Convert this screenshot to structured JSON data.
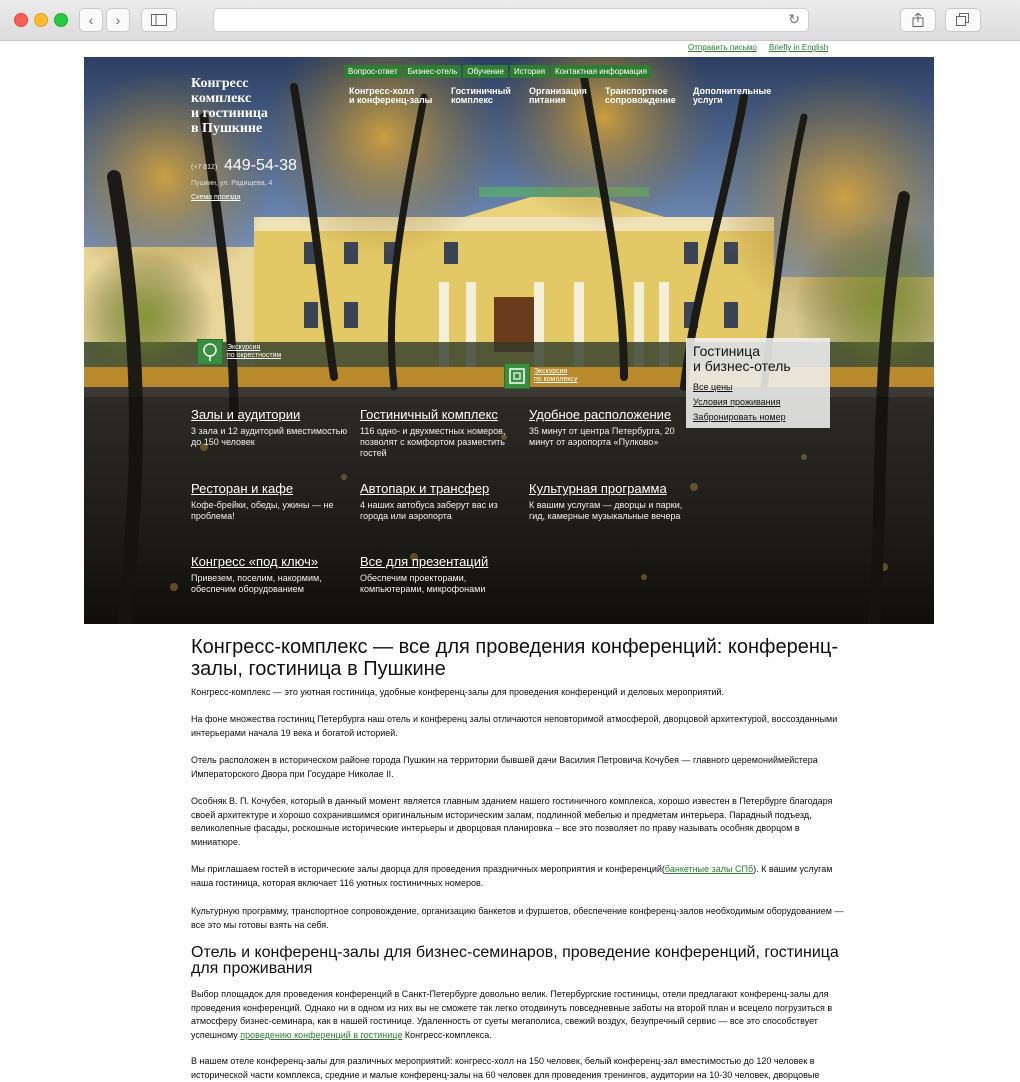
{
  "utility_links": {
    "send_letter": "Отправить письмо",
    "english": "Briefly in English"
  },
  "logo": {
    "line1": "Конгресс",
    "line2": "комплекс",
    "line3": "и гостиница",
    "line4": "в Пушкине"
  },
  "contact": {
    "phone_prefix": "(+7 812)",
    "phone": "449-54-38",
    "address": "Пушкин, ул. Радищева, 4",
    "scheme": "Схема проезда"
  },
  "top_nav": [
    "Вопрос-ответ",
    "Бизнес-отель",
    "Обучение",
    "История",
    "Контактная информация"
  ],
  "main_nav": [
    {
      "line1": "Конгресс-холл",
      "line2": "и конференц-залы"
    },
    {
      "line1": "Гостиничный",
      "line2": "комплекс"
    },
    {
      "line1": "Организация",
      "line2": "питания"
    },
    {
      "line1": "Транспортное",
      "line2": "сопровождение"
    },
    {
      "line1": "Дополнительные",
      "line2": "услуги"
    }
  ],
  "tours": {
    "surroundings": {
      "line1": "Экскурсия",
      "line2": "по окрестностям"
    },
    "complex": {
      "line1": "Экскурсия",
      "line2": "по комплексу"
    }
  },
  "hotel_box": {
    "title_line1": "Гостиница",
    "title_line2": "и бизнес-отель",
    "prices": "Все цены",
    "conditions": "Условия проживания",
    "book": "Забронировать номер"
  },
  "features": [
    {
      "title": "Залы и аудитории",
      "desc": "3 зала и 12 аудиторий вместимостью до 150 человек"
    },
    {
      "title": "Гостиничный комплекс",
      "desc": "116 одно- и двухместных номеров, позволят с комфортом разместить гостей"
    },
    {
      "title": "Удобное расположение",
      "desc": "35 минут от центра Петербурга, 20 минут от аэропорта «Пулково»"
    },
    {
      "title": "Ресторан и кафе",
      "desc": "Кофе-брейки, обеды, ужины — не проблема!"
    },
    {
      "title": "Автопарк и трансфер",
      "desc": "4 наших автобуса заберут вас из города или аэропорта"
    },
    {
      "title": "Культурная программа",
      "desc": "К вашим услугам — дворцы и парки, гид, камерные музыкальные вечера"
    },
    {
      "title": "Конгресс «под ключ»",
      "desc": "Привезем, поселим, накормим, обеспечим оборудованием"
    },
    {
      "title": "Все для презентаций",
      "desc": "Обеспечим проекторами, компьютерами, микрофонами"
    }
  ],
  "article": {
    "h1": "Конгресс-комплекс — все для проведения конференций: конференц-залы, гостиница в Пушкине",
    "p1": "Конгресс-комплекс — это уютная гостиница, удобные конференц-залы для проведения конференций и деловых мероприятий.",
    "p2": "На фоне множества гостиниц Петербурга наш отель и конференц залы  отличаются неповторимой атмосферой, дворцовой архитектурой, воссозданными интерьерами начала 19 века и богатой историей.",
    "p3": "Отель расположен в историческом районе города Пушкин на территории бывшей дачи Василия Петровича Кочубея — главного церемониймейстера Императорского Двора при Государе Николае II.",
    "p4": "Особняк В. П. Кочубея, который в данный момент является главным зданием нашего гостиничного комплекса, хорошо известен в Петербурге благодаря своей архитектуре и хорошо сохранившимся оригинальным историческим залам, подлинной мебелью и предметам интерьера. Парадный подъезд, великолепные фасады, роскошные исторические интерьеры и дворцовая планировка – все это позволяет по праву называть особняк дворцом в миниатюре.",
    "p5_a": "Мы приглашаем гостей в исторические залы дворца для проведения праздничных мероприятия и конференций(",
    "p5_link": "банкетные залы СПб",
    "p5_b": "). К вашим услугам наша гостиница, которая включает 116 уютных гостиничных номеров.",
    "p6": "Культурную программу, транспортное сопровождение, организацию банкетов и фуршетов, обеспечение конференц-залов необходимым оборудованием — все это мы готовы взять на себя.",
    "h2": "Отель и конференц-залы для бизнес-семинаров, проведение конференций, гостиница для проживания",
    "p7_a": "Выбор площадок для проведения конференций в Санкт-Петербурге довольно велик. Петербургские гостиницы, отели предлагают конференц-залы для проведения конференций. Однако ни в одном из них вы не сможете так легко отодвинуть повседневные заботы на второй план и всецело погрузиться в атмосферу бизнес-семинара, как в нашей гостинице. Удаленность от суеты мегаполиса, свежий воздух, безупречный сервис — все это способствует успешному ",
    "p7_link": "проведению конференций в гостинице",
    "p7_b": " Конгресс-комплекса.",
    "p8": "В нашем отеле конференц-залы для различных мероприятий: конгресс-холл на 150 человек, белый конференц-зал вместимостью до 120 человек в исторической части комплекса, средние и малые конференц-залы на 60 человек для проведения тренингов, аудитории на 10-30 человек, дворцовые"
  }
}
